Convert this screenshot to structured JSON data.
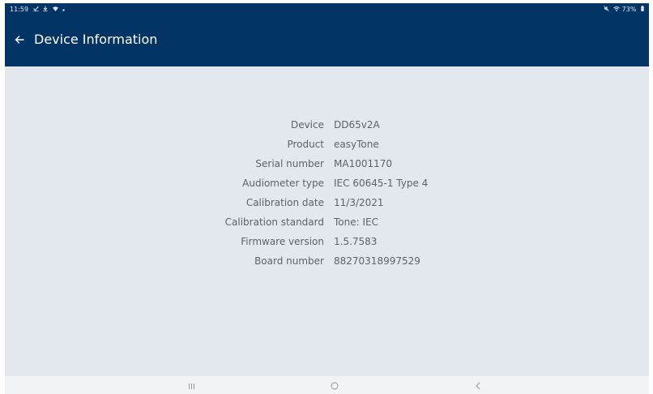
{
  "status_bar": {
    "time": "11:59",
    "left_icons": [
      "check-icon",
      "download-icon",
      "wifi-icon",
      "dot-icon"
    ],
    "battery": "73%",
    "right_icons": [
      "mute-icon",
      "wifi-icon",
      "battery-icon"
    ]
  },
  "app_bar": {
    "title": "Device Information",
    "back_icon": "arrow-left-icon"
  },
  "device_info": [
    {
      "label": "Device",
      "value": "DD65v2A"
    },
    {
      "label": "Product",
      "value": "easyTone"
    },
    {
      "label": "Serial number",
      "value": "MA1001170"
    },
    {
      "label": "Audiometer type",
      "value": "IEC 60645-1 Type 4"
    },
    {
      "label": "Calibration date",
      "value": "11/3/2021"
    },
    {
      "label": "Calibration standard",
      "value": "Tone: IEC"
    },
    {
      "label": "Firmware version",
      "value": "1.5.7583"
    },
    {
      "label": "Board number",
      "value": "88270318997529"
    }
  ],
  "nav_bar": {
    "recents_icon": "recents-icon",
    "home_icon": "home-icon",
    "back_icon": "back-chevron-icon"
  },
  "colors": {
    "app_bar": "#033466",
    "content_bg": "#e3e7ee",
    "text": "#5e6268",
    "nav_bar": "#f2f3f6"
  }
}
